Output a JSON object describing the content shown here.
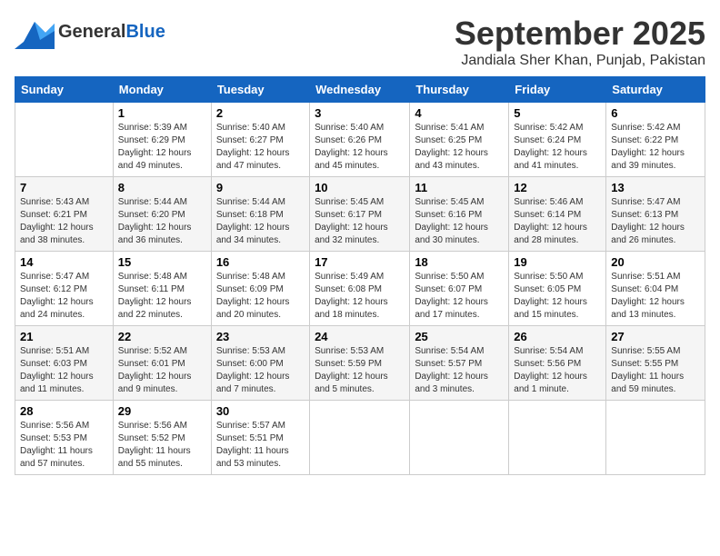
{
  "logo": {
    "general": "General",
    "blue": "Blue"
  },
  "title": "September 2025",
  "location": "Jandiala Sher Khan, Punjab, Pakistan",
  "weekdays": [
    "Sunday",
    "Monday",
    "Tuesday",
    "Wednesday",
    "Thursday",
    "Friday",
    "Saturday"
  ],
  "weeks": [
    [
      {
        "day": "",
        "sunrise": "",
        "sunset": "",
        "daylight": ""
      },
      {
        "day": "1",
        "sunrise": "Sunrise: 5:39 AM",
        "sunset": "Sunset: 6:29 PM",
        "daylight": "Daylight: 12 hours and 49 minutes."
      },
      {
        "day": "2",
        "sunrise": "Sunrise: 5:40 AM",
        "sunset": "Sunset: 6:27 PM",
        "daylight": "Daylight: 12 hours and 47 minutes."
      },
      {
        "day": "3",
        "sunrise": "Sunrise: 5:40 AM",
        "sunset": "Sunset: 6:26 PM",
        "daylight": "Daylight: 12 hours and 45 minutes."
      },
      {
        "day": "4",
        "sunrise": "Sunrise: 5:41 AM",
        "sunset": "Sunset: 6:25 PM",
        "daylight": "Daylight: 12 hours and 43 minutes."
      },
      {
        "day": "5",
        "sunrise": "Sunrise: 5:42 AM",
        "sunset": "Sunset: 6:24 PM",
        "daylight": "Daylight: 12 hours and 41 minutes."
      },
      {
        "day": "6",
        "sunrise": "Sunrise: 5:42 AM",
        "sunset": "Sunset: 6:22 PM",
        "daylight": "Daylight: 12 hours and 39 minutes."
      }
    ],
    [
      {
        "day": "7",
        "sunrise": "Sunrise: 5:43 AM",
        "sunset": "Sunset: 6:21 PM",
        "daylight": "Daylight: 12 hours and 38 minutes."
      },
      {
        "day": "8",
        "sunrise": "Sunrise: 5:44 AM",
        "sunset": "Sunset: 6:20 PM",
        "daylight": "Daylight: 12 hours and 36 minutes."
      },
      {
        "day": "9",
        "sunrise": "Sunrise: 5:44 AM",
        "sunset": "Sunset: 6:18 PM",
        "daylight": "Daylight: 12 hours and 34 minutes."
      },
      {
        "day": "10",
        "sunrise": "Sunrise: 5:45 AM",
        "sunset": "Sunset: 6:17 PM",
        "daylight": "Daylight: 12 hours and 32 minutes."
      },
      {
        "day": "11",
        "sunrise": "Sunrise: 5:45 AM",
        "sunset": "Sunset: 6:16 PM",
        "daylight": "Daylight: 12 hours and 30 minutes."
      },
      {
        "day": "12",
        "sunrise": "Sunrise: 5:46 AM",
        "sunset": "Sunset: 6:14 PM",
        "daylight": "Daylight: 12 hours and 28 minutes."
      },
      {
        "day": "13",
        "sunrise": "Sunrise: 5:47 AM",
        "sunset": "Sunset: 6:13 PM",
        "daylight": "Daylight: 12 hours and 26 minutes."
      }
    ],
    [
      {
        "day": "14",
        "sunrise": "Sunrise: 5:47 AM",
        "sunset": "Sunset: 6:12 PM",
        "daylight": "Daylight: 12 hours and 24 minutes."
      },
      {
        "day": "15",
        "sunrise": "Sunrise: 5:48 AM",
        "sunset": "Sunset: 6:11 PM",
        "daylight": "Daylight: 12 hours and 22 minutes."
      },
      {
        "day": "16",
        "sunrise": "Sunrise: 5:48 AM",
        "sunset": "Sunset: 6:09 PM",
        "daylight": "Daylight: 12 hours and 20 minutes."
      },
      {
        "day": "17",
        "sunrise": "Sunrise: 5:49 AM",
        "sunset": "Sunset: 6:08 PM",
        "daylight": "Daylight: 12 hours and 18 minutes."
      },
      {
        "day": "18",
        "sunrise": "Sunrise: 5:50 AM",
        "sunset": "Sunset: 6:07 PM",
        "daylight": "Daylight: 12 hours and 17 minutes."
      },
      {
        "day": "19",
        "sunrise": "Sunrise: 5:50 AM",
        "sunset": "Sunset: 6:05 PM",
        "daylight": "Daylight: 12 hours and 15 minutes."
      },
      {
        "day": "20",
        "sunrise": "Sunrise: 5:51 AM",
        "sunset": "Sunset: 6:04 PM",
        "daylight": "Daylight: 12 hours and 13 minutes."
      }
    ],
    [
      {
        "day": "21",
        "sunrise": "Sunrise: 5:51 AM",
        "sunset": "Sunset: 6:03 PM",
        "daylight": "Daylight: 12 hours and 11 minutes."
      },
      {
        "day": "22",
        "sunrise": "Sunrise: 5:52 AM",
        "sunset": "Sunset: 6:01 PM",
        "daylight": "Daylight: 12 hours and 9 minutes."
      },
      {
        "day": "23",
        "sunrise": "Sunrise: 5:53 AM",
        "sunset": "Sunset: 6:00 PM",
        "daylight": "Daylight: 12 hours and 7 minutes."
      },
      {
        "day": "24",
        "sunrise": "Sunrise: 5:53 AM",
        "sunset": "Sunset: 5:59 PM",
        "daylight": "Daylight: 12 hours and 5 minutes."
      },
      {
        "day": "25",
        "sunrise": "Sunrise: 5:54 AM",
        "sunset": "Sunset: 5:57 PM",
        "daylight": "Daylight: 12 hours and 3 minutes."
      },
      {
        "day": "26",
        "sunrise": "Sunrise: 5:54 AM",
        "sunset": "Sunset: 5:56 PM",
        "daylight": "Daylight: 12 hours and 1 minute."
      },
      {
        "day": "27",
        "sunrise": "Sunrise: 5:55 AM",
        "sunset": "Sunset: 5:55 PM",
        "daylight": "Daylight: 11 hours and 59 minutes."
      }
    ],
    [
      {
        "day": "28",
        "sunrise": "Sunrise: 5:56 AM",
        "sunset": "Sunset: 5:53 PM",
        "daylight": "Daylight: 11 hours and 57 minutes."
      },
      {
        "day": "29",
        "sunrise": "Sunrise: 5:56 AM",
        "sunset": "Sunset: 5:52 PM",
        "daylight": "Daylight: 11 hours and 55 minutes."
      },
      {
        "day": "30",
        "sunrise": "Sunrise: 5:57 AM",
        "sunset": "Sunset: 5:51 PM",
        "daylight": "Daylight: 11 hours and 53 minutes."
      },
      {
        "day": "",
        "sunrise": "",
        "sunset": "",
        "daylight": ""
      },
      {
        "day": "",
        "sunrise": "",
        "sunset": "",
        "daylight": ""
      },
      {
        "day": "",
        "sunrise": "",
        "sunset": "",
        "daylight": ""
      },
      {
        "day": "",
        "sunrise": "",
        "sunset": "",
        "daylight": ""
      }
    ]
  ]
}
